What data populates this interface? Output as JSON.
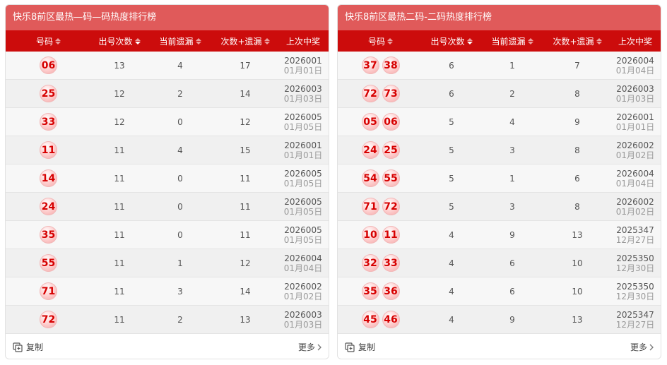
{
  "panels": [
    {
      "title": "快乐8前区最热—码—码热度排行榜",
      "headers": [
        "号码",
        "出号次数",
        "当前遗漏",
        "次数+遗漏",
        "上次中奖"
      ],
      "copy_label": "复制",
      "more_label": "更多",
      "rows": [
        {
          "balls": [
            "06"
          ],
          "count": "13",
          "miss": "4",
          "sum": "17",
          "issue": "2026001",
          "date": "01月01日"
        },
        {
          "balls": [
            "25"
          ],
          "count": "12",
          "miss": "2",
          "sum": "14",
          "issue": "2026003",
          "date": "01月03日"
        },
        {
          "balls": [
            "33"
          ],
          "count": "12",
          "miss": "0",
          "sum": "12",
          "issue": "2026005",
          "date": "01月05日"
        },
        {
          "balls": [
            "11"
          ],
          "count": "11",
          "miss": "4",
          "sum": "15",
          "issue": "2026001",
          "date": "01月01日"
        },
        {
          "balls": [
            "14"
          ],
          "count": "11",
          "miss": "0",
          "sum": "11",
          "issue": "2026005",
          "date": "01月05日"
        },
        {
          "balls": [
            "24"
          ],
          "count": "11",
          "miss": "0",
          "sum": "11",
          "issue": "2026005",
          "date": "01月05日"
        },
        {
          "balls": [
            "35"
          ],
          "count": "11",
          "miss": "0",
          "sum": "11",
          "issue": "2026005",
          "date": "01月05日"
        },
        {
          "balls": [
            "55"
          ],
          "count": "11",
          "miss": "1",
          "sum": "12",
          "issue": "2026004",
          "date": "01月04日"
        },
        {
          "balls": [
            "71"
          ],
          "count": "11",
          "miss": "3",
          "sum": "14",
          "issue": "2026002",
          "date": "01月02日"
        },
        {
          "balls": [
            "72"
          ],
          "count": "11",
          "miss": "2",
          "sum": "13",
          "issue": "2026003",
          "date": "01月03日"
        }
      ]
    },
    {
      "title": "快乐8前区最热二码-二码热度排行榜",
      "headers": [
        "号码",
        "出号次数",
        "当前遗漏",
        "次数+遗漏",
        "上次中奖"
      ],
      "copy_label": "复制",
      "more_label": "更多",
      "rows": [
        {
          "balls": [
            "37",
            "38"
          ],
          "count": "6",
          "miss": "1",
          "sum": "7",
          "issue": "2026004",
          "date": "01月04日"
        },
        {
          "balls": [
            "72",
            "73"
          ],
          "count": "6",
          "miss": "2",
          "sum": "8",
          "issue": "2026003",
          "date": "01月03日"
        },
        {
          "balls": [
            "05",
            "06"
          ],
          "count": "5",
          "miss": "4",
          "sum": "9",
          "issue": "2026001",
          "date": "01月01日"
        },
        {
          "balls": [
            "24",
            "25"
          ],
          "count": "5",
          "miss": "3",
          "sum": "8",
          "issue": "2026002",
          "date": "01月02日"
        },
        {
          "balls": [
            "54",
            "55"
          ],
          "count": "5",
          "miss": "1",
          "sum": "6",
          "issue": "2026004",
          "date": "01月04日"
        },
        {
          "balls": [
            "71",
            "72"
          ],
          "count": "5",
          "miss": "3",
          "sum": "8",
          "issue": "2026002",
          "date": "01月02日"
        },
        {
          "balls": [
            "10",
            "11"
          ],
          "count": "4",
          "miss": "9",
          "sum": "13",
          "issue": "2025347",
          "date": "12月27日"
        },
        {
          "balls": [
            "32",
            "33"
          ],
          "count": "4",
          "miss": "6",
          "sum": "10",
          "issue": "2025350",
          "date": "12月30日"
        },
        {
          "balls": [
            "35",
            "36"
          ],
          "count": "4",
          "miss": "6",
          "sum": "10",
          "issue": "2025350",
          "date": "12月30日"
        },
        {
          "balls": [
            "45",
            "46"
          ],
          "count": "4",
          "miss": "9",
          "sum": "13",
          "issue": "2025347",
          "date": "12月27日"
        }
      ]
    }
  ],
  "colors": {
    "title_bg": "#e05a5a",
    "header_bg": "#cc0c0c",
    "ball_text": "#d60000"
  },
  "icons": {
    "copy": "copy-icon",
    "more": "chevron-right-icon",
    "sort": "sort-arrows-icon"
  }
}
